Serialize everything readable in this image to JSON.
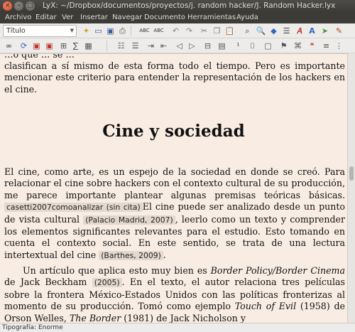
{
  "window": {
    "title": "LyX: ~/Dropbox/documentos/proyectos/j. random hacker/J. Random Hacker.lyx"
  },
  "menu": [
    "Archivo",
    "Editar",
    "Ver",
    "Insertar",
    "Navegar",
    "Documento",
    "Herramientas",
    "Ayuda"
  ],
  "toolbar": {
    "paragraph_style": "Título"
  },
  "document": {
    "cut_line": "…o que … se …",
    "para1": "clasifican a sí mismo de esta forma todo el tiempo. Pero es importante mencionar este criterio para entender la representación de los hackers en el cine.",
    "heading": "Cine y sociedad",
    "para2_a": "El cine, como arte, es un espejo de la sociedad en donde se creó. Para relacionar el cine sobre hackers con el contexto cultural de su producción, me parece importante plantear algunas premisas teóricas básicas.",
    "cite1": "casetti2007comoanalizar (sin cita)",
    "para2_b": "El cine puede ser analizado desde un punto de vista cultural",
    "cite2": "(Palacio Madrid, 2007)",
    "para2_c": ", leerlo como un texto y comprender los elementos significantes relevantes para el estudio. Esto tomando en cuenta el contexto social. En este sentido, se trata de una lectura intertextual del cine",
    "cite3": "(Barthes, 2009)",
    "para2_d": ".",
    "para3_a": "Un artículo que aplica esto muy bien es ",
    "para3_em1": "Border Policy/Border Cinema",
    "para3_b": " de Jack Beckham",
    "cite4": "(2005)",
    "para3_c": ". En el texto, el autor relaciona tres películas sobre la frontera México-Estados Unidos con las políticas fronterizas al momento de su producción. Tomó como ejemplo ",
    "para3_em2": "Touch of Evil",
    "para3_d": " (1958) de Orson Welles, ",
    "para3_em3": "The Border",
    "para3_e": " (1981) de Jack Nicholson y"
  },
  "status": "Tipografía: Enorme"
}
